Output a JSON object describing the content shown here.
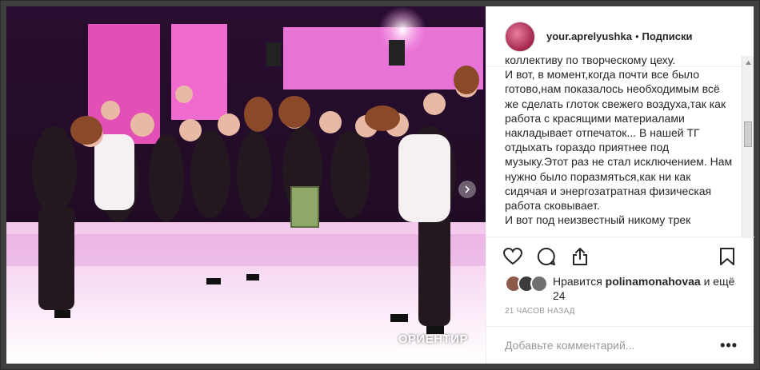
{
  "post": {
    "image_alt": "",
    "watermark": "ОРИЕНТИР"
  },
  "header": {
    "username": "your.aprelyushka",
    "separator": "•",
    "follow_label": "Подписки"
  },
  "caption": {
    "text": "коллективу по творческому цеху.\nИ вот, в момент,когда почти все было готово,нам показалось необходимым всё же сделать глоток свежего воздуха,так как работа с красящими материалами накладывает отпечаток... В нашей ТГ отдыхать гораздо приятнее под музыку.Этот раз не стал исключением. Нам нужно было поразмяться,как ни как сидячая и энергозатратная физическая работа сковывает.\nИ вот под неизвестный никому трек"
  },
  "actions": {
    "like_icon": "heart-icon",
    "comment_icon": "comment-icon",
    "share_icon": "share-icon",
    "save_icon": "bookmark-icon"
  },
  "likes": {
    "prefix": "Нравится",
    "user": "polinamonahovaa",
    "suffix": "и ещё 24"
  },
  "timestamp": "21 часов назад",
  "comment": {
    "placeholder": "Добавьте комментарий...",
    "more_label": "•••"
  },
  "colors": {
    "stage_pink": "#e03ea8",
    "panel_bg": "#ffffff",
    "text": "#262626",
    "muted": "#999999"
  }
}
